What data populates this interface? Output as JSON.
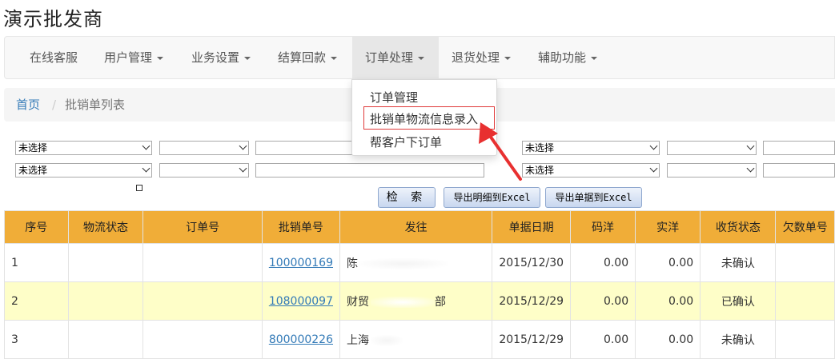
{
  "app": {
    "title": "演示批发商"
  },
  "nav": {
    "items": [
      {
        "label": "在线客服"
      },
      {
        "label": "用户管理"
      },
      {
        "label": "业务设置"
      },
      {
        "label": "结算回款"
      },
      {
        "label": "订单处理"
      },
      {
        "label": "退货处理"
      },
      {
        "label": "辅助功能"
      }
    ],
    "active_index": 4
  },
  "dropdown": {
    "items": [
      {
        "label": "订单管理"
      },
      {
        "label": "批销单物流信息录入"
      },
      {
        "label": "帮客户下订单"
      }
    ],
    "highlight_color": "#e03a3a"
  },
  "breadcrumb": {
    "home": "首页",
    "separator": "/",
    "current": "批销单列表"
  },
  "filters": {
    "row1_select1": "未选择",
    "row2_select1": "未选择",
    "row1_select3": "未选择",
    "row2_select3": "未选择"
  },
  "buttons": {
    "search": "检 索",
    "export_detail": "导出明细到Excel",
    "export_doc": "导出单据到Excel"
  },
  "table": {
    "columns": [
      "序号",
      "物流状态",
      "订单号",
      "批销单号",
      "发往",
      "单据日期",
      "码洋",
      "实洋",
      "收货状态",
      "欠数单号"
    ],
    "rows": [
      {
        "seq": "1",
        "logistics": "",
        "order_no": "",
        "doc_no": "100000169",
        "dest": "陈",
        "date": "2015/12/30",
        "list_price": "0.00",
        "net_price": "0.00",
        "receipt": "未确认",
        "owed": ""
      },
      {
        "seq": "2",
        "logistics": "",
        "order_no": "",
        "doc_no": "108000097",
        "dest": "财贸",
        "dest_tail": "部",
        "date": "2015/12/29",
        "list_price": "0.00",
        "net_price": "0.00",
        "receipt": "已确认",
        "owed": ""
      },
      {
        "seq": "3",
        "logistics": "",
        "order_no": "",
        "doc_no": "800000226",
        "dest": "上海",
        "date": "2015/12/29",
        "list_price": "0.00",
        "net_price": "0.00",
        "receipt": "未确认",
        "owed": ""
      }
    ]
  },
  "colors": {
    "header_bg": "#f0ad38",
    "alt_row_bg": "#fefec8",
    "link": "#337ab7",
    "arrow": "#e83030"
  }
}
